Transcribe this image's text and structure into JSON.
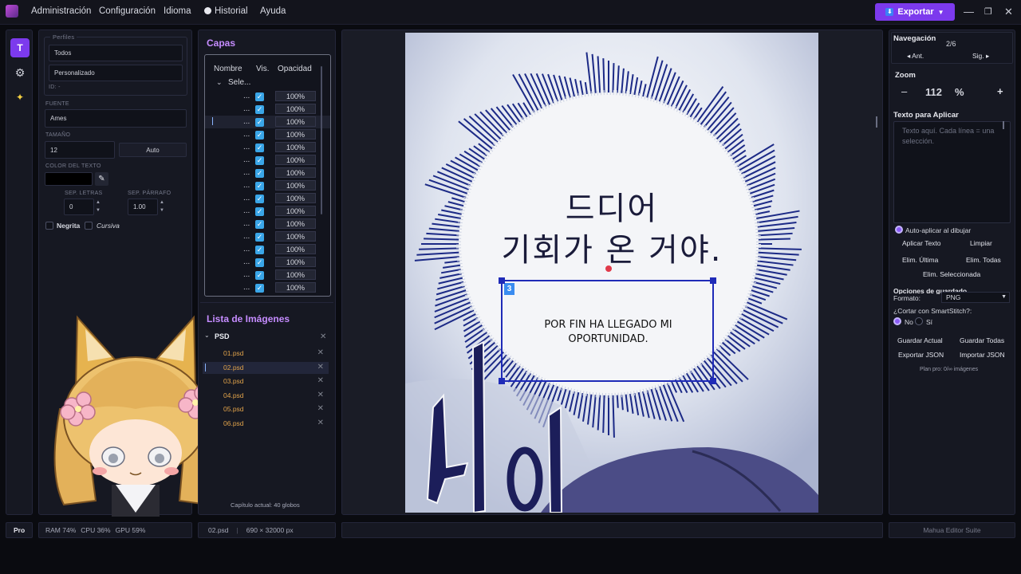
{
  "menu": {
    "items": [
      "Administración",
      "Configuración",
      "Idioma",
      "Historial",
      "Ayuda"
    ],
    "export_label": "Exportar"
  },
  "rail": {
    "text_tool": "T"
  },
  "props": {
    "profiles_legend": "Perfiles",
    "profile_all": "Todos",
    "profile_custom": "Personalizado",
    "id_label": "ID: -",
    "font_label": "FUENTE",
    "font_value": "Ames",
    "size_label": "TAMAÑO",
    "size_value": "12",
    "auto_label": "Auto",
    "color_label": "COLOR DEL TEXTO",
    "text_color": "#000000",
    "letter_sp_label": "SEP. LETRAS",
    "letter_sp_value": "0",
    "para_sp_label": "SEP. PÁRRAFO",
    "para_sp_value": "1.00",
    "bold_label": "Negrita",
    "italic_label": "Cursiva"
  },
  "layers": {
    "title": "Capas",
    "col_name": "Nombre",
    "col_vis": "Vis.",
    "col_opacity": "Opacidad",
    "group_label": "Sele...",
    "row_name": "...",
    "row_opacity": "100%",
    "row_count": 16
  },
  "images": {
    "title": "Lista de Imágenes",
    "group": "PSD",
    "files": [
      "01.psd",
      "02.psd",
      "03.psd",
      "04.psd",
      "05.psd",
      "06.psd"
    ],
    "selected_index": 1,
    "chapter_status": "Capítulo actual: 40 globos"
  },
  "canvas": {
    "korean_line1": "드디어",
    "korean_line2": "기회가 온 거야.",
    "box_number": "3",
    "translation": "POR FIN HA LLEGADO MI OPORTUNIDAD.",
    "sfx": "사아"
  },
  "right": {
    "nav_title": "Navegación",
    "nav_page": "2/6",
    "prev_label": "◂ Ant.",
    "next_label": "Sig. ▸",
    "zoom_title": "Zoom",
    "zoom_value": "112",
    "zoom_unit": "%",
    "zoom_minus": "–",
    "zoom_plus": "+",
    "text_title": "Texto para Aplicar",
    "text_placeholder": "Texto aquí. Cada línea = una selección.",
    "auto_apply": "Auto-aplicar al dibujar",
    "apply_btn": "Aplicar Texto",
    "clear_btn": "Limpiar",
    "del_last": "Elim. Última",
    "del_all": "Elim. Todas",
    "del_selected": "Elim. Seleccionada",
    "save_title": "Opciones de guardado",
    "format_label": "Formato:",
    "format_value": "PNG",
    "smartstitch_label": "¿Cortar con SmartStitch?:",
    "opt_no": "No",
    "opt_yes": "Sí",
    "save_current": "Guardar Actual",
    "save_all": "Guardar Todas",
    "export_json": "Exportar JSON",
    "import_json": "Importar JSON",
    "plan": "Plan pro: 0/∞ imágenes"
  },
  "status": {
    "pro": "Pro",
    "ram": "RAM 74%",
    "cpu": "CPU 36%",
    "gpu": "GPU 59%",
    "file": "02.psd",
    "dims": "690 × 32000 px",
    "brand": "Mahua Editor Suite"
  },
  "colors": {
    "accent": "#7c3aed",
    "section": "#c58cff",
    "file": "#e0a24a",
    "check": "#3aa6e8",
    "box": "#1f2bb8"
  }
}
